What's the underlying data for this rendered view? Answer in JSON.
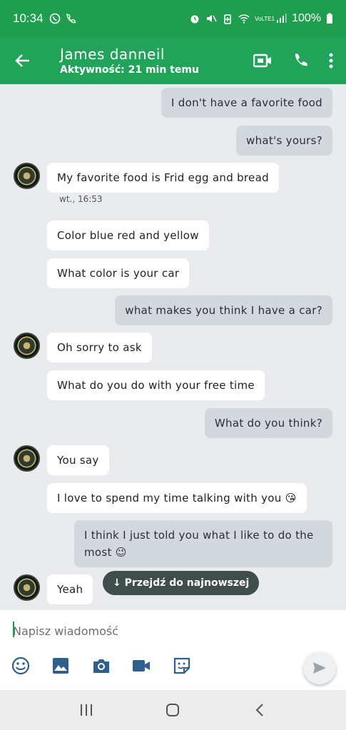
{
  "status_bar": {
    "time": "10:34",
    "battery": "100%",
    "network": "VoLTE1",
    "icons": [
      "whatsapp-icon",
      "phone-icon",
      "alarm-icon",
      "mute-icon",
      "battery-saver-icon",
      "wifi-icon",
      "signal-icon",
      "battery-icon"
    ]
  },
  "header": {
    "name": "James danneil",
    "status": "Aktywność: 21 min temu",
    "icons": [
      "back-arrow-icon",
      "video-call-icon",
      "phone-call-icon",
      "more-vert-icon"
    ]
  },
  "messages": [
    {
      "dir": "out",
      "text": "I don't have a favorite food"
    },
    {
      "dir": "out",
      "text": "what's yours?"
    },
    {
      "dir": "in",
      "text": "My favorite food is Frid egg and bread",
      "avatar": true
    },
    {
      "dir": "meta",
      "text": "wt., 16:53"
    },
    {
      "dir": "in",
      "text": "Color blue red and yellow"
    },
    {
      "dir": "in",
      "text": "What color is your car"
    },
    {
      "dir": "out",
      "text": "what makes you think I have a car?"
    },
    {
      "dir": "in",
      "text": "Oh sorry to ask",
      "avatar": true
    },
    {
      "dir": "in",
      "text": "What do you do with your free time"
    },
    {
      "dir": "out",
      "text": "What do you think?"
    },
    {
      "dir": "in",
      "text": "You say",
      "avatar": true
    },
    {
      "dir": "in",
      "text": "I love to spend my time talking with you 😘"
    },
    {
      "dir": "out",
      "text": "I think I just told you what I like to do the most 😉"
    },
    {
      "dir": "in",
      "text": "Yeah",
      "avatar": true
    }
  ],
  "jump_button": "↓ Przejdź do najnowszej",
  "composer": {
    "placeholder": "Napisz wiadomość",
    "tools": [
      "emoji-icon",
      "image-icon",
      "camera-icon",
      "video-icon",
      "sticker-icon"
    ],
    "send_icon": "send-icon"
  },
  "nav_bar": [
    "recents-icon",
    "home-icon",
    "back-icon"
  ],
  "colors": {
    "status_bar": "#1e9e4e",
    "app_bar": "#21a35a",
    "outgoing_bubble": "#d3d8de",
    "incoming_bubble": "#ffffff",
    "chat_background": "#e9ebee"
  }
}
